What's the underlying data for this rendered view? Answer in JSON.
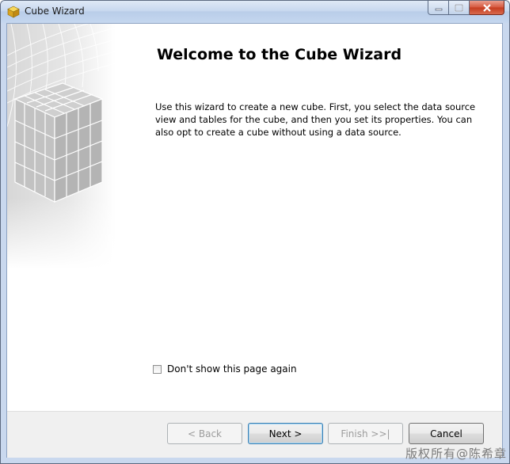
{
  "window": {
    "title": "Cube Wizard",
    "icon": "cube-icon"
  },
  "caption_buttons": {
    "minimize": "minimize-icon",
    "maximize": "maximize-icon",
    "close": "close-icon"
  },
  "page": {
    "heading": "Welcome to the Cube Wizard",
    "description": "Use this wizard to create a new cube. First, you select the data source view and tables for the cube, and then you set its properties. You can also opt to create a cube without using a data source."
  },
  "options": {
    "dont_show_label": "Don't show this page again",
    "dont_show_checked": false
  },
  "buttons": {
    "back": "< Back",
    "next": "Next >",
    "finish": "Finish >>|",
    "cancel": "Cancel"
  },
  "watermark": "版权所有@陈希章",
  "colors": {
    "title_bar": "#c8d8ef",
    "close_button": "#d5563c",
    "default_button_border": "#3c7fb1"
  }
}
